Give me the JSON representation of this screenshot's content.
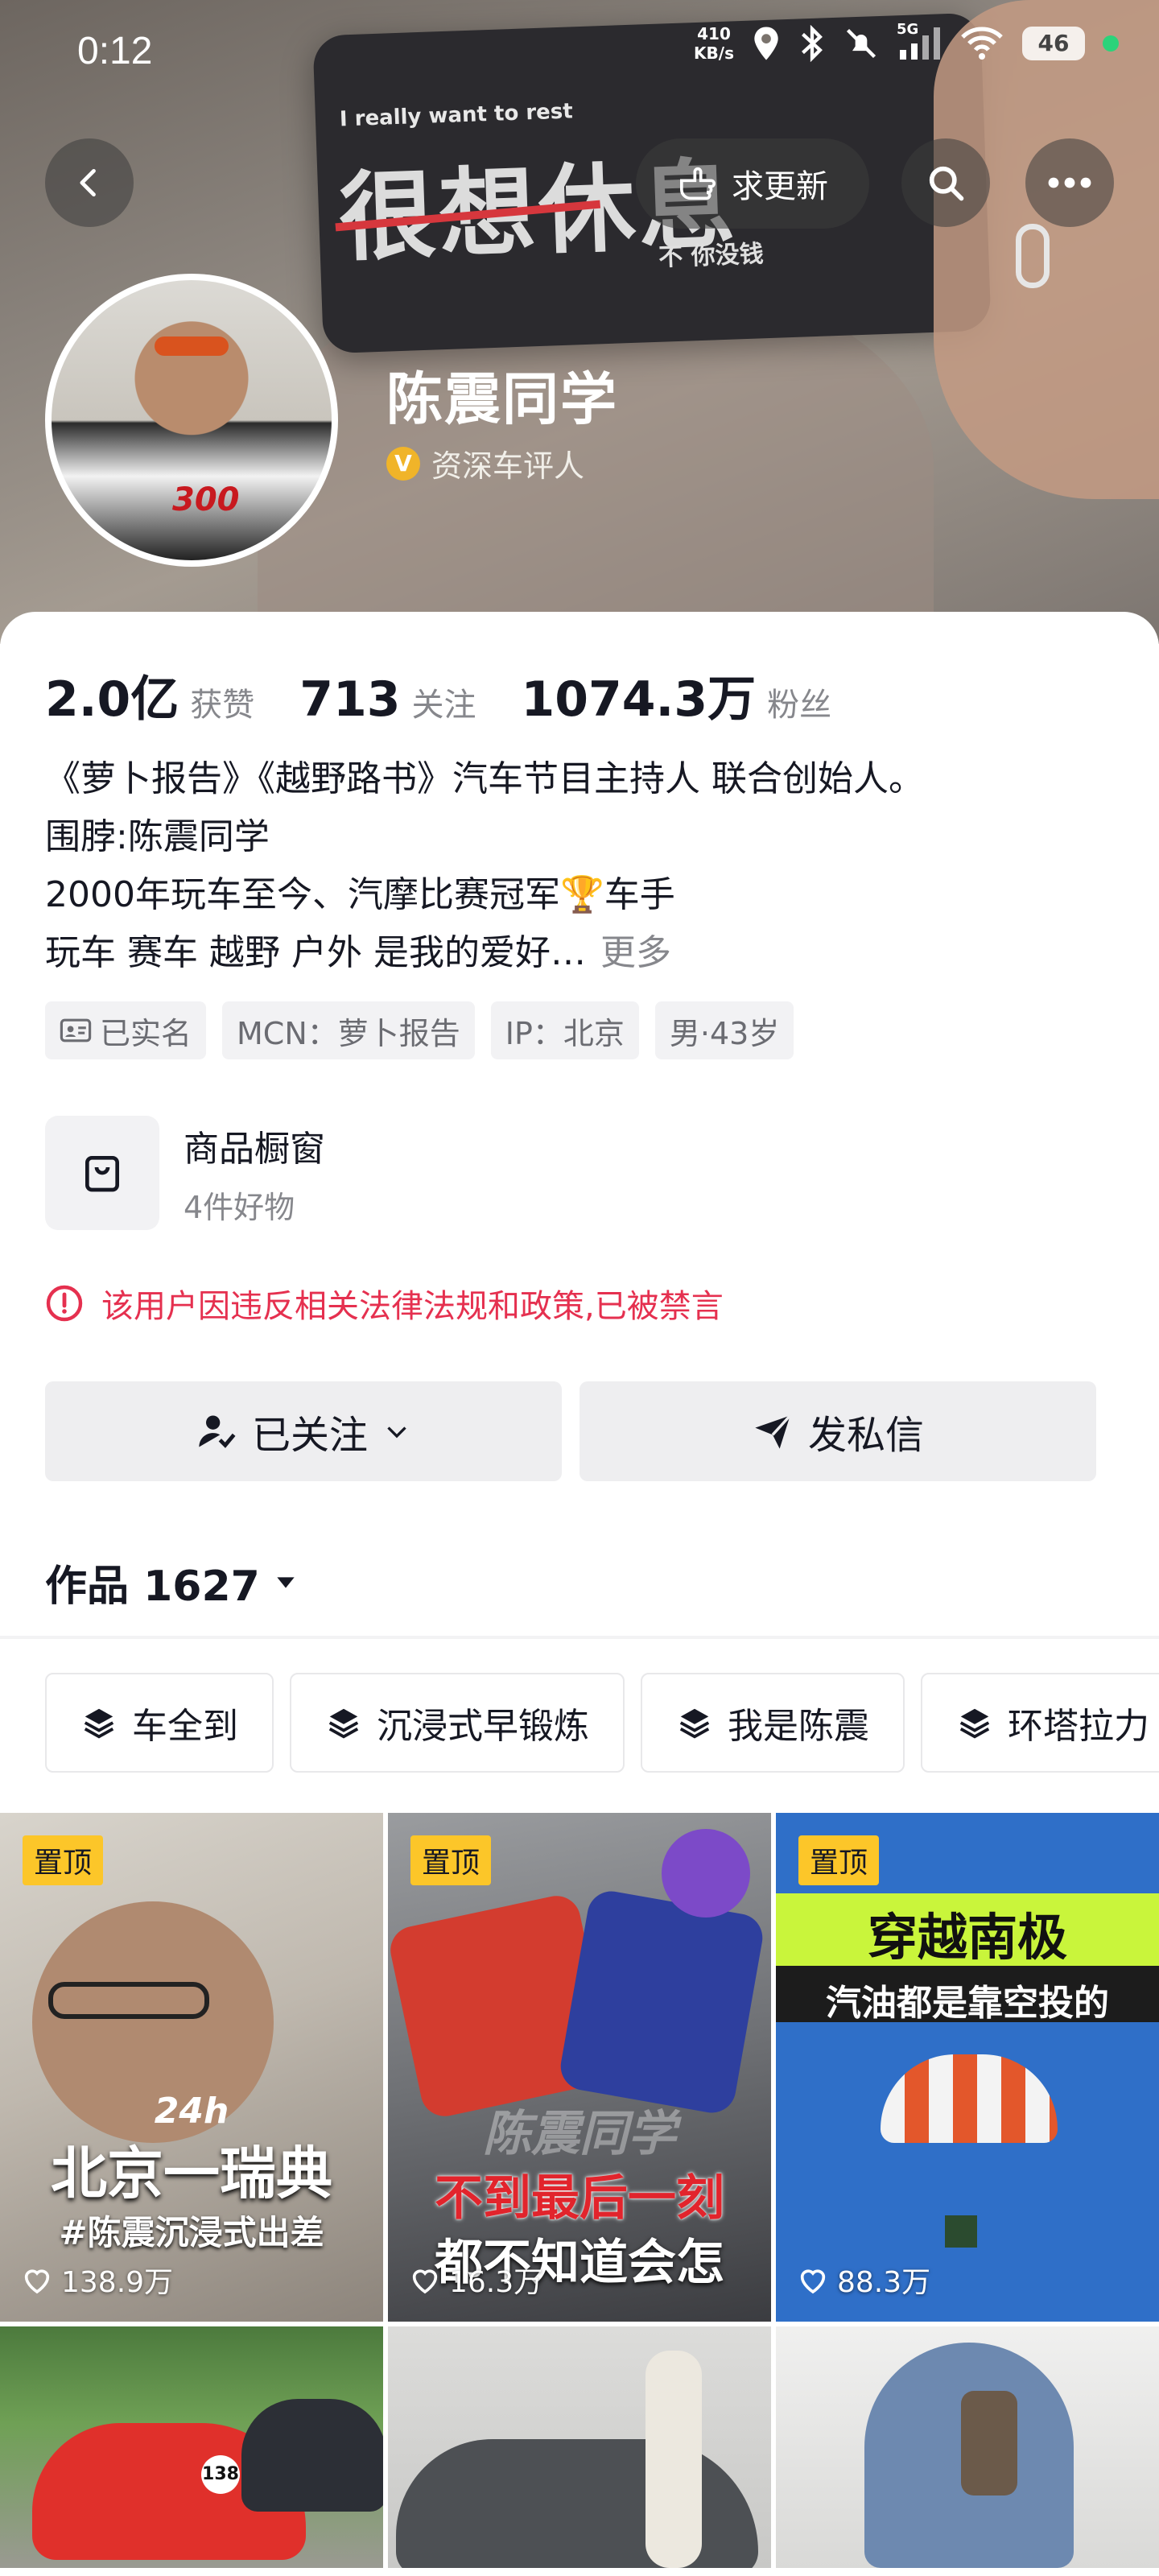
{
  "status": {
    "time": "0:12",
    "net_speed_value": "410",
    "net_speed_unit": "KB/s",
    "signal": "5G",
    "battery": "46"
  },
  "hero": {
    "phone_en": "I really want to rest",
    "phone_cn": "很想休息",
    "phone_sub": "不 你没钱",
    "update_button": "求更新"
  },
  "profile": {
    "name": "陈震同学",
    "verify_badge": "V",
    "verify_label": "资深车评人",
    "avatar_number": "300"
  },
  "stats": [
    {
      "value": "2.0亿",
      "label": "获赞"
    },
    {
      "value": "713",
      "label": "关注"
    },
    {
      "value": "1074.3万",
      "label": "粉丝"
    }
  ],
  "bio": {
    "line1": "《萝卜报告》《越野路书》汽车节目主持人 联合创始人。",
    "line2": "围脖:陈震同学",
    "line3": "2000年玩车至今、汽摩比赛冠军🏆车手",
    "line4": "玩车 赛车 越野 户外 是我的爱好…",
    "more": "更多"
  },
  "tags": [
    "已实名",
    "MCN：萝卜报告",
    "IP：北京",
    "男·43岁"
  ],
  "shop": {
    "title": "商品橱窗",
    "subtitle": "4件好物"
  },
  "ban_notice": "该用户因违反相关法律法规和政策,已被禁言",
  "actions": {
    "follow": "已关注",
    "message": "发私信"
  },
  "works": {
    "label": "作品 1627"
  },
  "collections": [
    "车全到",
    "沉浸式早锻炼",
    "我是陈震",
    "环塔拉力"
  ],
  "videos": [
    {
      "pinned": "置顶",
      "line1": "24h",
      "line2": "北京一瑞典",
      "line3": "#陈震沉浸式出差",
      "likes": "138.9万"
    },
    {
      "pinned": "置顶",
      "line1": "陈震同学",
      "line2": "不到最后一刻",
      "line3": "都不知道会怎",
      "likes": "16.3万"
    },
    {
      "pinned": "置顶",
      "line1": "穿越南极",
      "line2": "汽油都是靠空投的",
      "line3": "",
      "likes": "88.3万"
    },
    {
      "pinned": "",
      "line1": "138",
      "line2": "",
      "line3": "",
      "likes": ""
    },
    {
      "pinned": "",
      "line1": "",
      "line2": "",
      "line3": "",
      "likes": ""
    },
    {
      "pinned": "",
      "line1": "",
      "line2": "",
      "line3": "",
      "likes": ""
    }
  ]
}
